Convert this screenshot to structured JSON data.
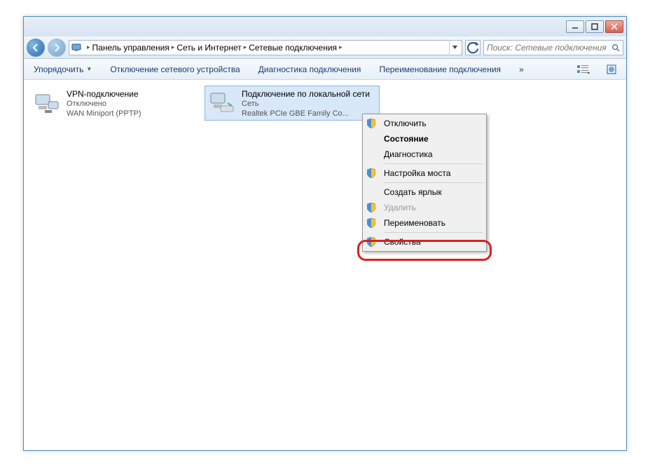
{
  "titlebar": {
    "min": "–",
    "max": "▢",
    "close": "✕"
  },
  "breadcrumbs": [
    "Панель управления",
    "Сеть и Интернет",
    "Сетевые подключения"
  ],
  "search_placeholder": "Поиск: Сетевые подключения",
  "toolbar": {
    "organize": "Упорядочить",
    "disable": "Отключение сетевого устройства",
    "diag": "Диагностика подключения",
    "rename": "Переименование подключения",
    "more": "»"
  },
  "connections": [
    {
      "name": "VPN-подключение",
      "status": "Отключено",
      "device": "WAN Miniport (PPTP)",
      "selected": false
    },
    {
      "name": "Подключение по локальной сети",
      "status": "Сеть",
      "device": "Realtek PCIe GBE Family Co...",
      "selected": true
    }
  ],
  "context_menu": [
    {
      "label": "Отключить",
      "shield": true
    },
    {
      "label": "Состояние",
      "bold": true
    },
    {
      "label": "Диагностика"
    },
    {
      "sep": true
    },
    {
      "label": "Настройка моста",
      "shield": true
    },
    {
      "sep": true
    },
    {
      "label": "Создать ярлык"
    },
    {
      "label": "Удалить",
      "shield": true,
      "disabled": true
    },
    {
      "label": "Переименовать",
      "shield": true
    },
    {
      "sep": true
    },
    {
      "label": "Свойства",
      "shield": true
    }
  ]
}
